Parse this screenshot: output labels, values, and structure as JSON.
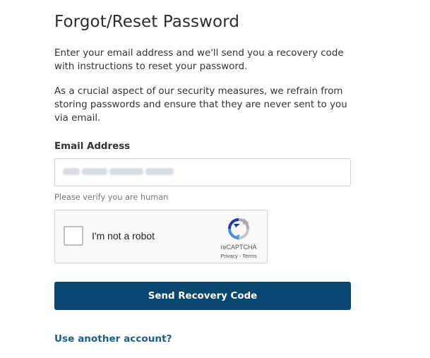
{
  "page": {
    "title": "Forgot/Reset Password",
    "intro_text": "Enter your email address and we'll send you a recovery code with instructions to reset your password.",
    "security_text": "As a crucial aspect of our security measures, we refrain from storing passwords and ensure that they are never sent to you via email."
  },
  "form": {
    "email_label": "Email Address",
    "email_value": "",
    "verify_hint": "Please verify you are human",
    "submit_label": "Send Recovery Code"
  },
  "recaptcha": {
    "checkbox_label": "I'm not a robot",
    "brand": "reCAPTCHA",
    "privacy_link": "Privacy",
    "separator": " - ",
    "terms_link": "Terms",
    "logo_icon": "recaptcha-logo-icon",
    "colors": {
      "blue": "#1c3aa9",
      "light_blue": "#4a90e2",
      "gray": "#ababab"
    }
  },
  "links": {
    "another_account": "Use another account?"
  },
  "colors": {
    "primary_button": "#0a4770",
    "link": "#1a5f8a",
    "title": "#2d2d2d"
  }
}
